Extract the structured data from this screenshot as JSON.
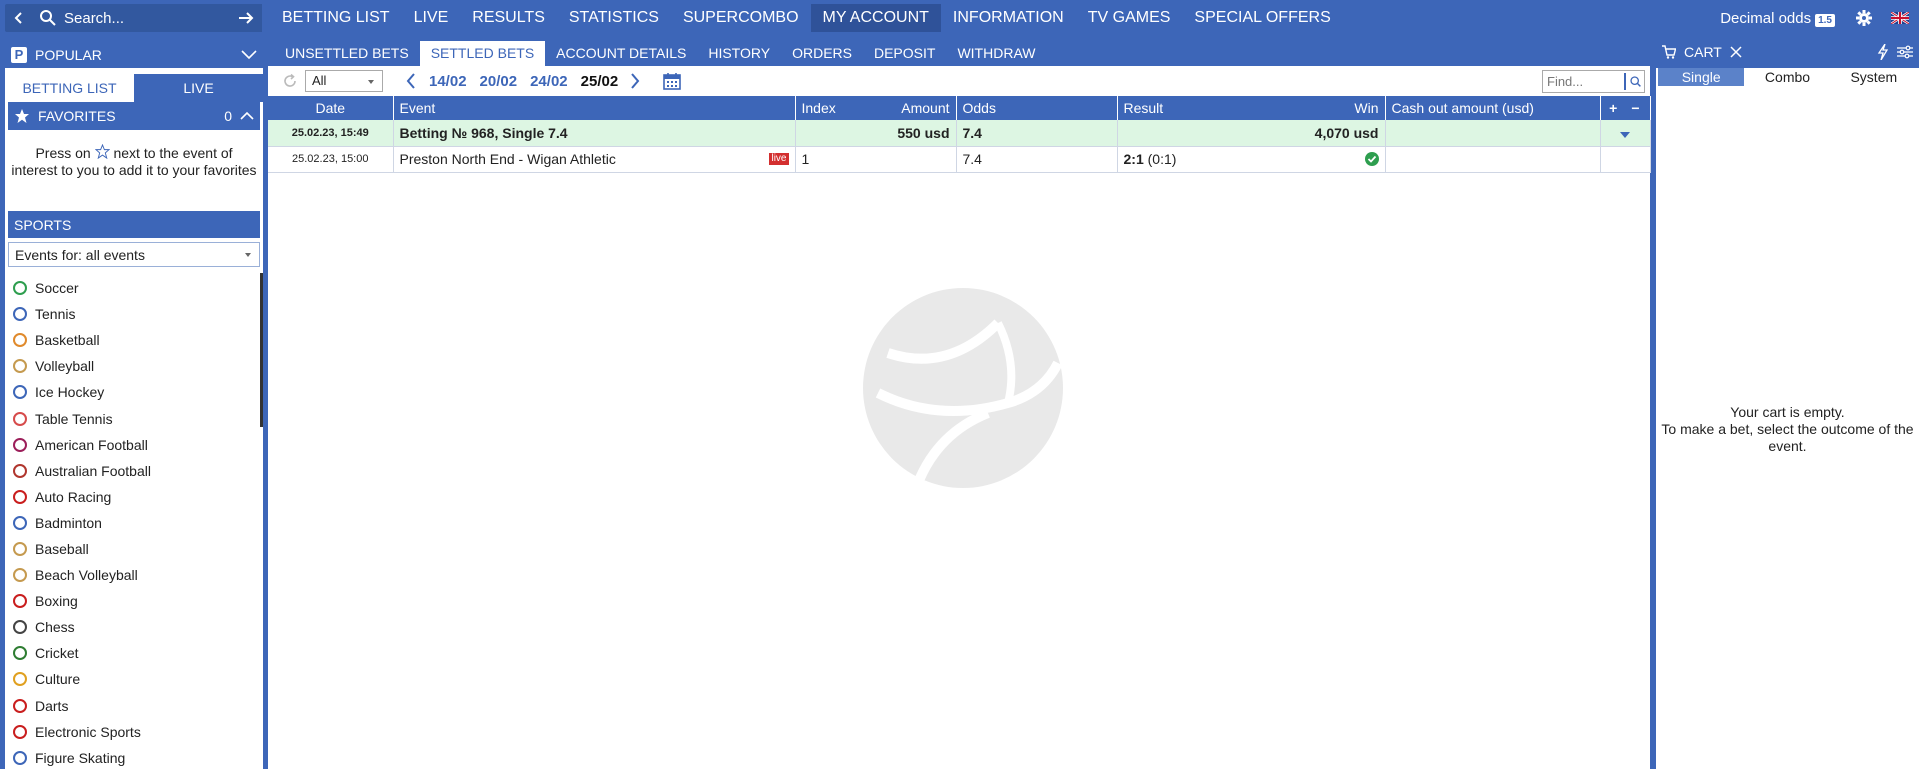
{
  "topbar": {
    "search_label": "Search...",
    "nav": [
      "BETTING LIST",
      "LIVE",
      "RESULTS",
      "STATISTICS",
      "SUPERCOMBO",
      "MY ACCOUNT",
      "INFORMATION",
      "TV GAMES",
      "SPECIAL OFFERS"
    ],
    "active_nav": "MY ACCOUNT",
    "odds_label": "Decimal odds",
    "odds_badge": "1.5"
  },
  "sidebar": {
    "popular_label": "POPULAR",
    "tabs": [
      "BETTING LIST",
      "LIVE"
    ],
    "favorites_label": "FAVORITES",
    "favorites_count": "0",
    "hint_part1": "Press on",
    "hint_part2": "next to the event of interest to you to add it to your favorites",
    "sports_label": "SPORTS",
    "events_filter": "Events for: all events",
    "sports": [
      {
        "name": "Soccer",
        "color": "#2e9e4f"
      },
      {
        "name": "Tennis",
        "color": "#3d66b8"
      },
      {
        "name": "Basketball",
        "color": "#e08a2c"
      },
      {
        "name": "Volleyball",
        "color": "#c59a4f"
      },
      {
        "name": "Ice Hockey",
        "color": "#3d66b8"
      },
      {
        "name": "Table Tennis",
        "color": "#d64b4b"
      },
      {
        "name": "American Football",
        "color": "#9c1f5a"
      },
      {
        "name": "Australian Football",
        "color": "#b0362e"
      },
      {
        "name": "Auto Racing",
        "color": "#c91e1e"
      },
      {
        "name": "Badminton",
        "color": "#3d66b8"
      },
      {
        "name": "Baseball",
        "color": "#c59a4f"
      },
      {
        "name": "Beach Volleyball",
        "color": "#c59a4f"
      },
      {
        "name": "Boxing",
        "color": "#c91e1e"
      },
      {
        "name": "Chess",
        "color": "#444444"
      },
      {
        "name": "Cricket",
        "color": "#2e7d32"
      },
      {
        "name": "Culture",
        "color": "#e0a020"
      },
      {
        "name": "Darts",
        "color": "#c91e1e"
      },
      {
        "name": "Electronic Sports",
        "color": "#c91e1e"
      },
      {
        "name": "Figure Skating",
        "color": "#3d66b8"
      }
    ]
  },
  "main": {
    "subnav": [
      "UNSETTLED BETS",
      "SETTLED BETS",
      "ACCOUNT DETAILS",
      "HISTORY",
      "ORDERS",
      "DEPOSIT",
      "WITHDRAW"
    ],
    "active_subnav": "SETTLED BETS",
    "filter_value": "All",
    "dates": [
      "14/02",
      "20/02",
      "24/02",
      "25/02"
    ],
    "current_date": "25/02",
    "find_placeholder": "Find...",
    "columns": {
      "date": "Date",
      "event": "Event",
      "index": "Index",
      "amount": "Amount",
      "odds": "Odds",
      "result": "Result",
      "win": "Win",
      "cashout": "Cash out amount (usd)",
      "plus": "+",
      "minus": "−"
    },
    "bet": {
      "date": "25.02.23, 15:49",
      "title": "Betting № 968, Single 7.4",
      "amount": "550 usd",
      "odds": "7.4",
      "win": "4,070 usd"
    },
    "event_row": {
      "date": "25.02.23, 15:00",
      "event": "Preston North End - Wigan Athletic",
      "live": "live",
      "index": "1",
      "odds": "7.4",
      "result_score": "2:1",
      "result_half": "(0:1)"
    }
  },
  "cart": {
    "title": "CART",
    "types": [
      "Single",
      "Combo",
      "System"
    ],
    "active_type": "Single",
    "empty_line1": "Your cart is empty.",
    "empty_line2": "To make a bet, select the outcome of the event."
  }
}
